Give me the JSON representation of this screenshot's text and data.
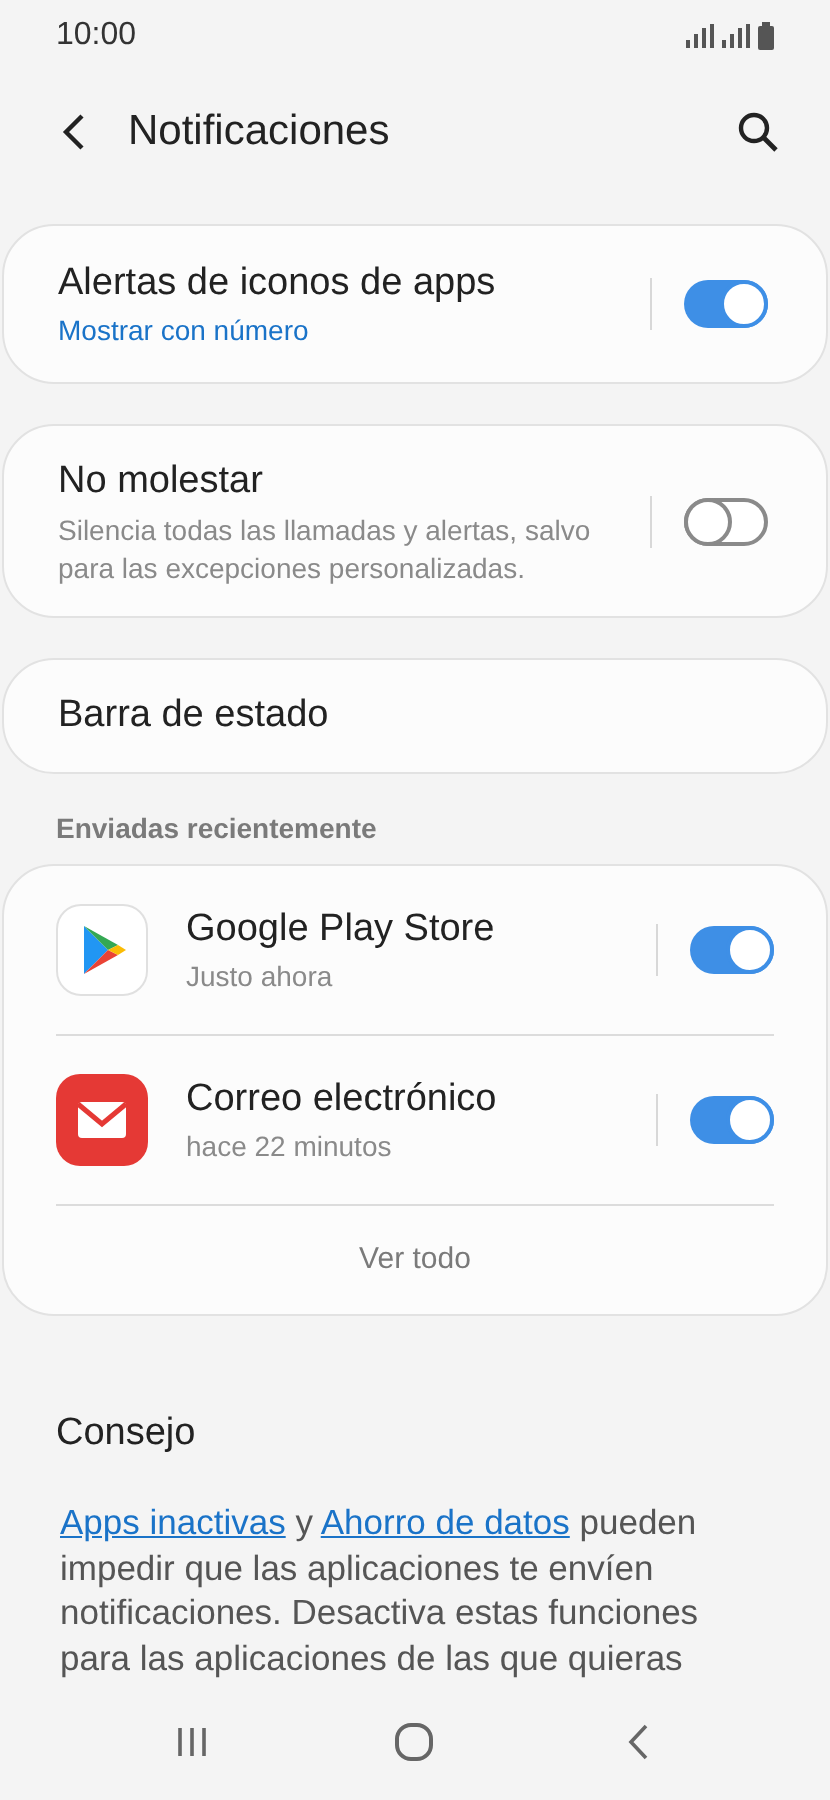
{
  "status_bar": {
    "time": "10:00"
  },
  "header": {
    "title": "Notificaciones"
  },
  "cards": [
    {
      "title": "Alertas de iconos de apps",
      "value": "Mostrar con número",
      "on": true
    },
    {
      "title": "No molestar",
      "description": "Silencia todas las llamadas y alertas, salvo para las excepciones personalizadas.",
      "on": false
    },
    {
      "title": "Barra de estado"
    }
  ],
  "recent": {
    "heading": "Enviadas recientemente",
    "apps": [
      {
        "kind": "play",
        "name": "Google Play Store",
        "time": "Justo ahora",
        "on": true
      },
      {
        "kind": "mail",
        "name": "Correo electrónico",
        "time": "hace 22 minutos",
        "on": true
      }
    ],
    "see_all": "Ver todo"
  },
  "tip": {
    "heading": "Consejo",
    "parts": [
      {
        "text": "Apps inactivas",
        "link": true
      },
      {
        "text": " y ",
        "link": false
      },
      {
        "text": "Ahorro de datos",
        "link": true
      },
      {
        "text": " pueden impedir que las aplicaciones te envíen notificaciones. Desactiva estas funciones para las aplicaciones de las que quieras",
        "link": false
      }
    ]
  }
}
